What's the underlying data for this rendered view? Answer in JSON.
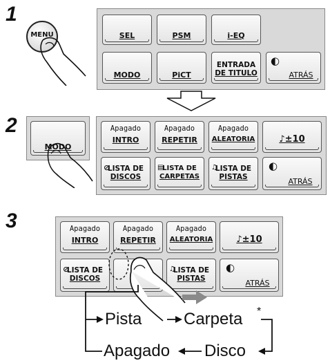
{
  "steps": {
    "s1": "1",
    "s2": "2",
    "s3": "3"
  },
  "menu_button": {
    "label": "MENU"
  },
  "step1": {
    "row1": [
      "SEL",
      "PSM",
      "i-EQ"
    ],
    "row2": [
      "MODO",
      "PiCT"
    ],
    "entrada": {
      "line1": "ENTRADA",
      "line2": "DE TITULO"
    },
    "atras": "ATRÁS"
  },
  "step2": {
    "modo": "MODO",
    "buttons": {
      "intro": {
        "state": "Apagado",
        "label": "INTRO"
      },
      "repetir": {
        "state": "Apagado",
        "label": "REPETIR"
      },
      "aleatoria": {
        "state": "Apagado",
        "label": "ALEATORIA"
      },
      "folder_skip": "♪±10",
      "lista_discos": {
        "line1": "LISTA DE",
        "line2": "DISCOS"
      },
      "lista_carpetas": {
        "line1": "LISTA DE",
        "line2": "CARPETAS"
      },
      "lista_pistas": {
        "line1": "LISTA DE",
        "line2": "PISTAS"
      },
      "atras": "ATRÁS"
    }
  },
  "step3": {
    "buttons": {
      "intro": {
        "state": "Apagado",
        "label": "INTRO"
      },
      "repetir": {
        "state": "Apagado",
        "label": "REPETIR"
      },
      "aleatoria": {
        "state": "Apagado",
        "label": "ALEATORIA"
      },
      "folder_skip": "♪±10",
      "lista_discos": {
        "line1": "LISTA DE",
        "line2": "DISCOS"
      },
      "lista_pistas": {
        "line1": "LISTA DE",
        "line2": "PISTAS"
      },
      "atras": "ATRÁS"
    },
    "cycle": {
      "pista": "Pista",
      "carpeta": "Carpeta",
      "asterisk": "*",
      "apagado": "Apagado",
      "disco": "Disco"
    }
  }
}
